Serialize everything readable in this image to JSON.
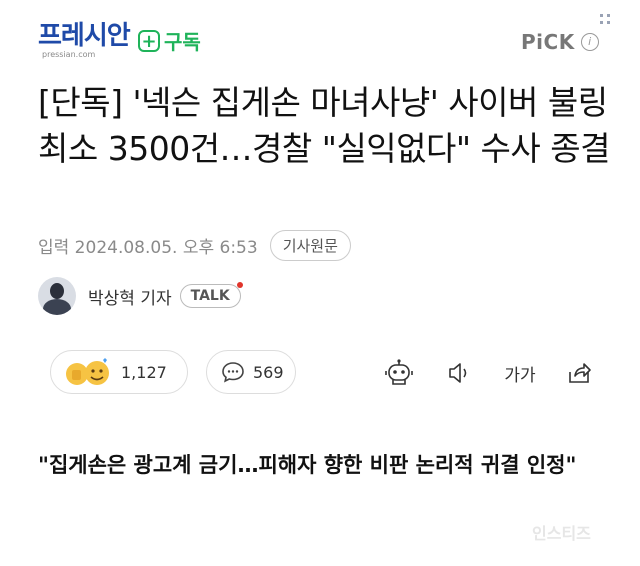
{
  "header": {
    "logo_text": "프레시안",
    "logo_sub": "pressian.com",
    "subscribe_label": "구독",
    "pick_label": "PiCK"
  },
  "article": {
    "title": "[단독] '넥슨 집게손 마녀사냥' 사이버 불링 최소 3500건…경찰 \"실익없다\" 수사 종결",
    "date": "입력 2024.08.05. 오후 6:53",
    "original_button": "기사원문",
    "reporter": "박상혁 기자",
    "talk_label": "TALK"
  },
  "actions": {
    "like_count": "1,127",
    "comment_count": "569",
    "font_size_label": "가가"
  },
  "subheading": "\"집게손은 광고계 금기…피해자 향한 비판 논리적 귀결 인정\"",
  "watermark": "인스티즈",
  "colors": {
    "brand": "#1f4aa8",
    "subscribe_green": "#1fb35a",
    "muted_text": "#8a8a8a"
  },
  "icons": [
    "info-icon",
    "like-emoji-icon",
    "comment-icon",
    "robot-summary-icon",
    "speaker-icon",
    "share-icon"
  ]
}
